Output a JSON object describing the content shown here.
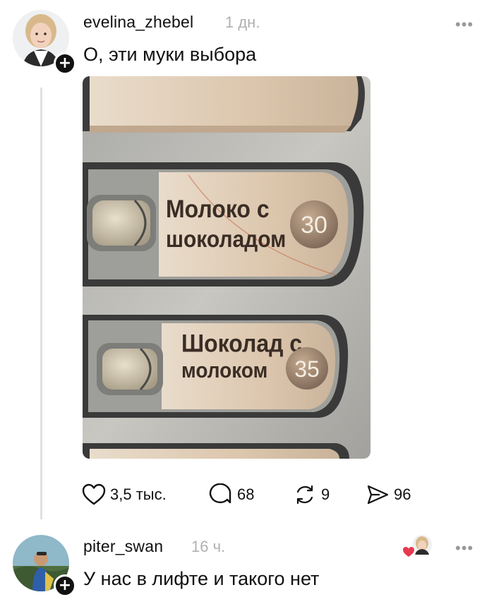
{
  "post": {
    "username": "evelina_zhebel",
    "time": "1 дн.",
    "text": "О, эти муки выбора",
    "image": {
      "button1_line1": "Молоко с",
      "button1_line2": "шоколадом",
      "button1_price": "30",
      "button2_line1": "Шоколад с",
      "button2_line2": "молоком",
      "button2_price": "35"
    },
    "actions": {
      "likes": "3,5 тыс.",
      "comments": "68",
      "reposts": "9",
      "shares": "96"
    }
  },
  "reply": {
    "username": "piter_swan",
    "time": "16 ч.",
    "text": "У нас в лифте и такого нет"
  },
  "icons": {
    "follow": "plus-icon",
    "more": "more-icon",
    "like": "heart-icon",
    "comment": "comment-icon",
    "repost": "repost-icon",
    "share": "send-icon",
    "liked_by_author": "heart-badge-icon"
  },
  "colors": {
    "text": "#111111",
    "muted": "#b0b0b0",
    "like_badge": "#e8384f"
  }
}
